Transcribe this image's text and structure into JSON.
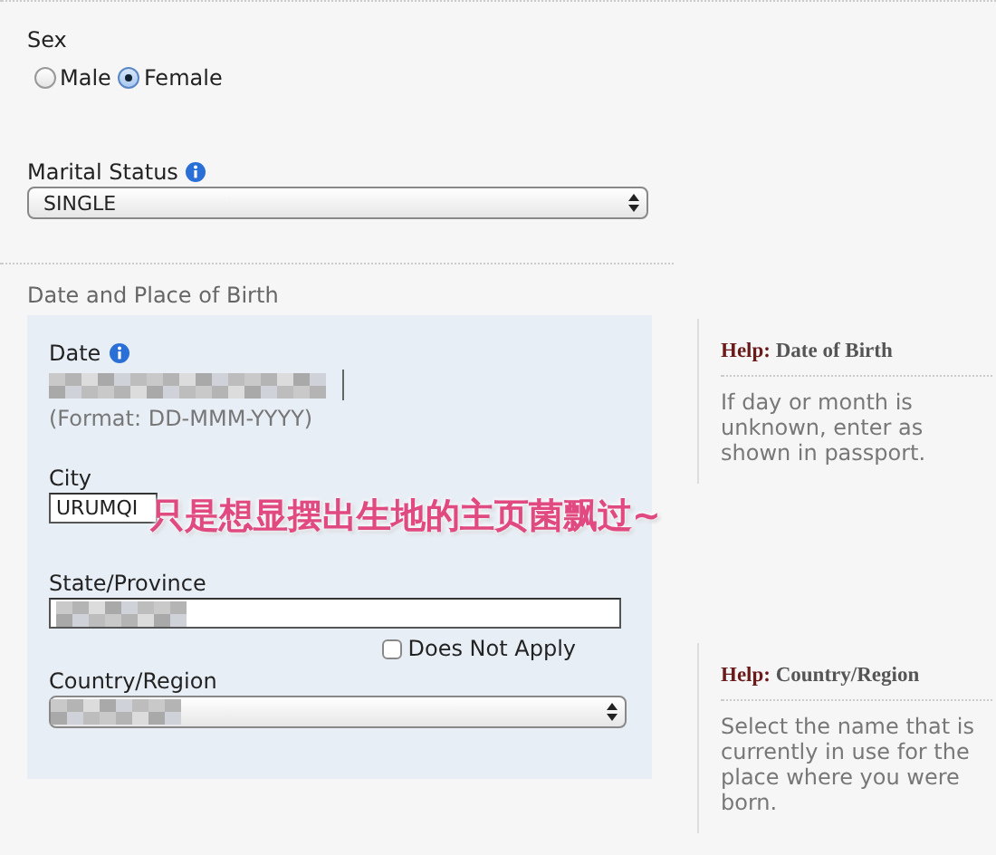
{
  "sex": {
    "label": "Sex",
    "options": [
      {
        "label": "Male",
        "selected": false
      },
      {
        "label": "Female",
        "selected": true
      }
    ]
  },
  "marital_status": {
    "label": "Marital Status",
    "value": "SINGLE"
  },
  "birth_section": {
    "title": "Date and Place of Birth",
    "date": {
      "label": "Date",
      "format_hint": "(Format: DD-MMM-YYYY)"
    },
    "city": {
      "label": "City",
      "value": "URUMQI"
    },
    "state": {
      "label": "State/Province",
      "does_not_apply": {
        "label": "Does Not Apply",
        "checked": false
      }
    },
    "country": {
      "label": "Country/Region"
    }
  },
  "help": [
    {
      "prefix": "Help:",
      "title": "Date of Birth",
      "text": "If day or month is unknown, enter as shown in passport."
    },
    {
      "prefix": "Help:",
      "title": "Country/Region",
      "text": "Select the name that is currently in use for the place where you were born."
    }
  ],
  "overlay_caption": "只是想显摆出生地的主页菌飘过~"
}
